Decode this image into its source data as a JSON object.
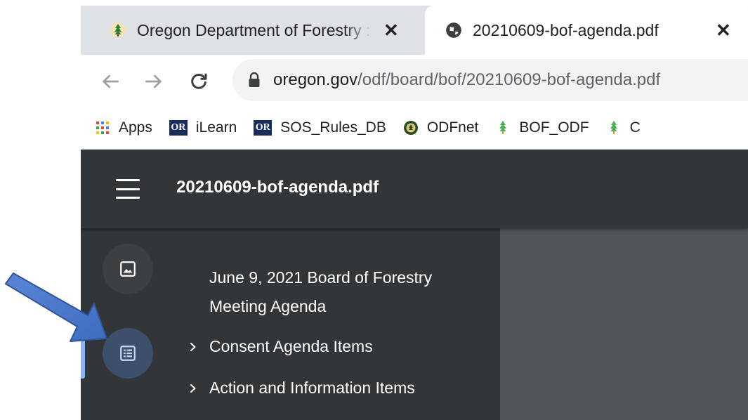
{
  "tabs": [
    {
      "title": "Oregon Department of Forestry : Board of Forestry",
      "favicon": "tree-icon",
      "active": false,
      "close": "✕"
    },
    {
      "title": "20210609-bof-agenda.pdf",
      "favicon": "globe-icon",
      "active": true,
      "close": "✕"
    }
  ],
  "toolbar": {
    "url_host": "oregon.gov",
    "url_path": "/odf/board/bof/20210609-bof-agenda.pdf"
  },
  "bookmarks": [
    {
      "label": "Apps",
      "icon": "apps-grid-icon"
    },
    {
      "label": "iLearn",
      "icon": "or-badge-icon",
      "badge": "OR"
    },
    {
      "label": "SOS_Rules_DB",
      "icon": "or-badge-icon",
      "badge": "OR"
    },
    {
      "label": "ODFnet",
      "icon": "odf-seal-icon"
    },
    {
      "label": "BOF_ODF",
      "icon": "tree-icon"
    },
    {
      "label": "C",
      "icon": "tree-icon"
    }
  ],
  "viewer": {
    "doc_title": "20210609-bof-agenda.pdf",
    "outline": {
      "title": "June 9, 2021 Board of Forestry Meeting Agenda",
      "items": [
        {
          "label": "Consent Agenda Items"
        },
        {
          "label": "Action and Information Items"
        }
      ]
    }
  },
  "colors": {
    "viewer_header": "#323639",
    "viewer_canvas": "#525659",
    "active_indicator": "#8ab4f8",
    "annotation_arrow": "#4472c4"
  }
}
